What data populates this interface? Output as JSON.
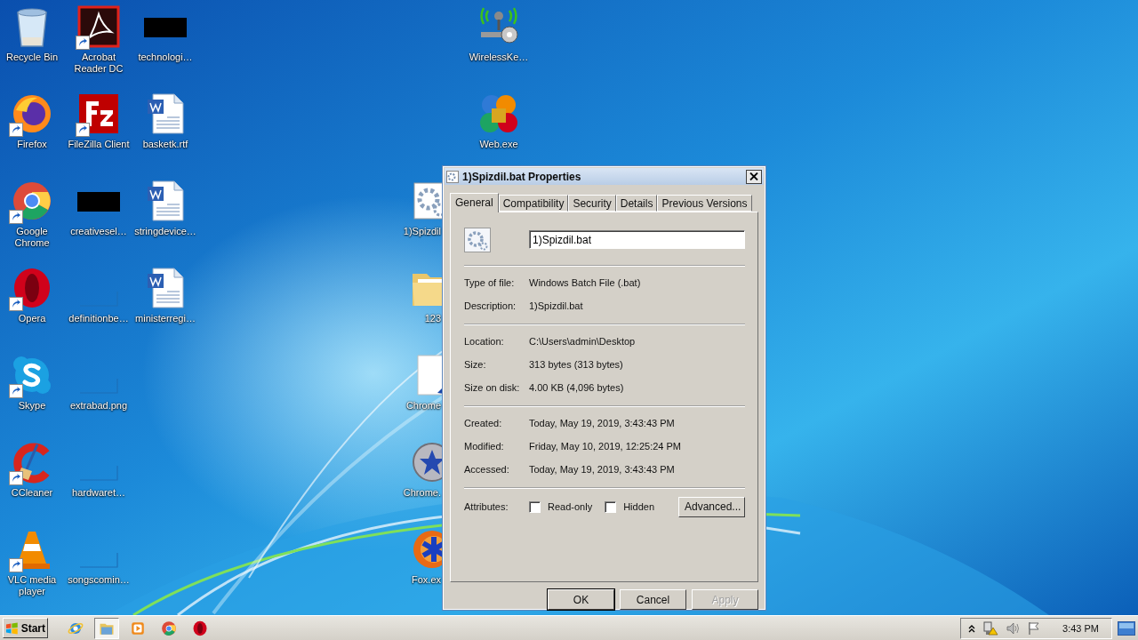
{
  "desktop_icons": [
    {
      "label": "Recycle Bin",
      "kind": "recycle",
      "shortcut": false
    },
    {
      "label": "Firefox",
      "kind": "firefox",
      "shortcut": true
    },
    {
      "label": "Google Chrome",
      "kind": "chrome",
      "shortcut": true
    },
    {
      "label": "Opera",
      "kind": "opera",
      "shortcut": true
    },
    {
      "label": "Skype",
      "kind": "skype",
      "shortcut": true
    },
    {
      "label": "CCleaner",
      "kind": "ccleaner",
      "shortcut": true
    },
    {
      "label": "VLC media player",
      "kind": "vlc",
      "shortcut": true
    },
    {
      "label": "Acrobat Reader DC",
      "kind": "acrobat",
      "shortcut": true
    },
    {
      "label": "FileZilla Client",
      "kind": "filezilla",
      "shortcut": true
    },
    {
      "label": "creativesel…",
      "kind": "dark",
      "shortcut": false
    },
    {
      "label": "definitionbe…",
      "kind": "blank",
      "shortcut": false
    },
    {
      "label": "extrabad.png",
      "kind": "blank",
      "shortcut": false
    },
    {
      "label": "hardwaret…",
      "kind": "blank",
      "shortcut": false
    },
    {
      "label": "songscomin…",
      "kind": "blank",
      "shortcut": false
    },
    {
      "label": "technologi…",
      "kind": "dark",
      "shortcut": false
    },
    {
      "label": "basketk.rtf",
      "kind": "doc",
      "shortcut": false
    },
    {
      "label": "stringdevice…",
      "kind": "doc",
      "shortcut": false
    },
    {
      "label": "ministerregi…",
      "kind": "doc",
      "shortcut": false
    },
    {
      "label": "1)Spizdil",
      "kind": "gears",
      "shortcut": false
    },
    {
      "label": "123",
      "kind": "folder",
      "shortcut": false
    },
    {
      "label": "Chrome",
      "kind": "page",
      "shortcut": false
    },
    {
      "label": "Chrome.",
      "kind": "starball",
      "shortcut": false
    },
    {
      "label": "Fox.ex",
      "kind": "foxball",
      "shortcut": false
    },
    {
      "label": "WirelessKe…",
      "kind": "wireless",
      "shortcut": false
    },
    {
      "label": "Web.exe",
      "kind": "web",
      "shortcut": false
    }
  ],
  "dialog": {
    "title": "1)Spizdil.bat Properties",
    "tabs": [
      {
        "label": "General",
        "selected": true
      },
      {
        "label": "Compatibility",
        "selected": false
      },
      {
        "label": "Security",
        "selected": false
      },
      {
        "label": "Details",
        "selected": false
      },
      {
        "label": "Previous Versions",
        "selected": false
      }
    ],
    "file_name": "1)Spizdil.bat",
    "sections": [
      [
        {
          "label": "Type of file:",
          "value": "Windows Batch File (.bat)"
        },
        {
          "label": "Description:",
          "value": "1)Spizdil.bat"
        }
      ],
      [
        {
          "label": "Location:",
          "value": "C:\\Users\\admin\\Desktop"
        },
        {
          "label": "Size:",
          "value": "313 bytes (313 bytes)"
        },
        {
          "label": "Size on disk:",
          "value": "4.00 KB (4,096 bytes)"
        }
      ],
      [
        {
          "label": "Created:",
          "value": "Today, May 19, 2019, 3:43:43 PM"
        },
        {
          "label": "Modified:",
          "value": "Friday, May 10, 2019, 12:25:24 PM"
        },
        {
          "label": "Accessed:",
          "value": "Today, May 19, 2019, 3:43:43 PM"
        }
      ]
    ],
    "attributes": {
      "label": "Attributes:",
      "checkboxes": [
        {
          "label": "Read-only",
          "checked": false
        },
        {
          "label": "Hidden",
          "checked": false
        }
      ],
      "advanced": "Advanced..."
    },
    "buttons": [
      {
        "label": "OK",
        "default": true,
        "disabled": false
      },
      {
        "label": "Cancel",
        "default": false,
        "disabled": false
      },
      {
        "label": "Apply",
        "default": false,
        "disabled": true
      }
    ]
  },
  "taskbar": {
    "start": "Start",
    "apps": [
      {
        "kind": "ie",
        "selected": false
      },
      {
        "kind": "explorer",
        "selected": true
      },
      {
        "kind": "media",
        "selected": false
      },
      {
        "kind": "chrome",
        "selected": false
      },
      {
        "kind": "opera",
        "selected": false
      }
    ],
    "clock": "3:43 PM"
  }
}
